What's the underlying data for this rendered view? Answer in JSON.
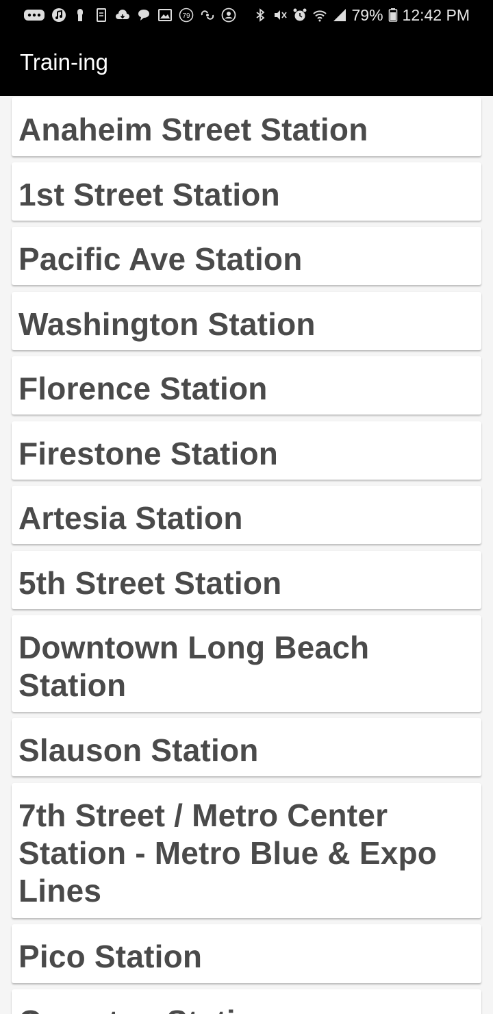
{
  "status_bar": {
    "battery": "79%",
    "time": "12:42 PM",
    "notification_count": "79",
    "icons": [
      "more-notifications-icon",
      "music-icon",
      "lock-icon",
      "sim-card-icon",
      "cloud-icon",
      "chat-bubble-icon",
      "image-icon",
      "badge-icon",
      "link-icon",
      "user-icon",
      "bluetooth-icon",
      "mute-icon",
      "alarm-icon",
      "wifi-icon",
      "signal-icon",
      "battery-icon"
    ]
  },
  "app_bar": {
    "title": "Train-ing"
  },
  "stations": [
    {
      "name": "Anaheim Street Station"
    },
    {
      "name": "1st Street Station"
    },
    {
      "name": "Pacific Ave Station"
    },
    {
      "name": "Washington Station"
    },
    {
      "name": "Florence Station"
    },
    {
      "name": "Firestone Station"
    },
    {
      "name": "Artesia Station"
    },
    {
      "name": "5th Street Station"
    },
    {
      "name": "Downtown Long Beach Station"
    },
    {
      "name": "Slauson Station"
    },
    {
      "name": "7th Street / Metro Center Station - Metro Blue & Expo Lines"
    },
    {
      "name": "Pico Station"
    },
    {
      "name": "Compton Station"
    }
  ],
  "colors": {
    "app_bar_bg": "#000000",
    "list_bg": "#f5f5f5",
    "card_bg": "#ffffff",
    "text": "#4a4a4a"
  }
}
